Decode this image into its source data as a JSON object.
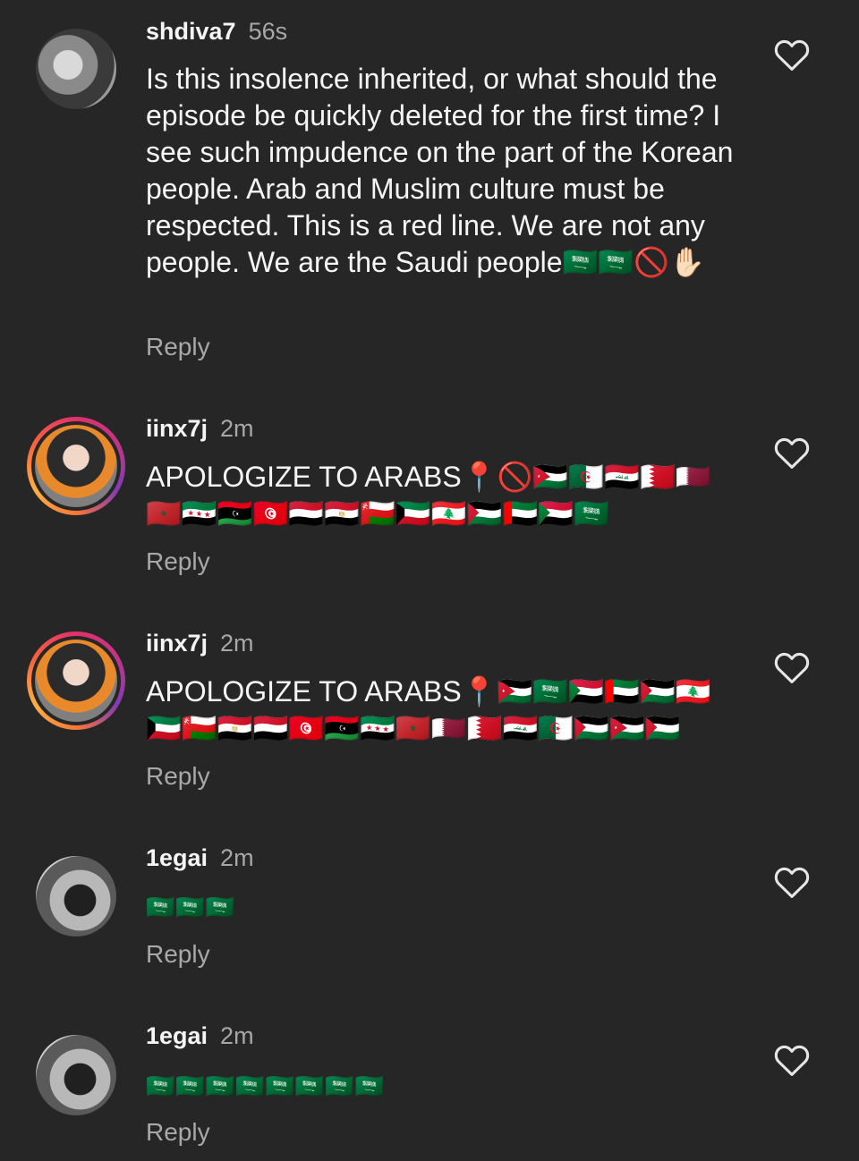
{
  "comments": [
    {
      "username": "shdiva7",
      "time": "56s",
      "text": "Is this insolence inherited, or what should the episode be quickly deleted for the first time? I see such impudence on the part of the Korean people. Arab and Muslim culture must be respected. This is a red line. We are not any people. We are the Saudi people🇸🇦🇸🇦🚫✋🏻",
      "reply": "Reply",
      "avatar": "avatar",
      "like_icon": "heart-icon"
    },
    {
      "username": "iinx7j",
      "time": "2m",
      "text": "APOLOGIZE TO ARABS📍🚫🇯🇴🇩🇿🇮🇶🇧🇭🇶🇦🇲🇦🇸🇾🇱🇾🇹🇳🇾🇪🇪🇬🇴🇲🇰🇼🇱🇧🇵🇸🇦🇪🇸🇩🇸🇦",
      "reply": "Reply",
      "avatar": "avatar",
      "like_icon": "heart-icon"
    },
    {
      "username": "iinx7j",
      "time": "2m",
      "text": "APOLOGIZE TO ARABS📍🇯🇴🇸🇦🇸🇩🇦🇪🇵🇸🇱🇧🇰🇼🇴🇲🇪🇬🇾🇪🇹🇳🇱🇾🇸🇾🇲🇦🇶🇦🇧🇭🇮🇶🇩🇿🇵🇸🇯🇴🇵🇸",
      "reply": "Reply",
      "avatar": "avatar",
      "like_icon": "heart-icon"
    },
    {
      "username": "1egai",
      "time": "2m",
      "text": "🇸🇦🇸🇦🇸🇦",
      "reply": "Reply",
      "avatar": "avatar",
      "like_icon": "heart-icon"
    },
    {
      "username": "1egai",
      "time": "2m",
      "text": "🇸🇦🇸🇦🇸🇦🇸🇦🇸🇦🇸🇦🇸🇦🇸🇦",
      "reply": "Reply",
      "avatar": "avatar",
      "like_icon": "heart-icon"
    }
  ]
}
